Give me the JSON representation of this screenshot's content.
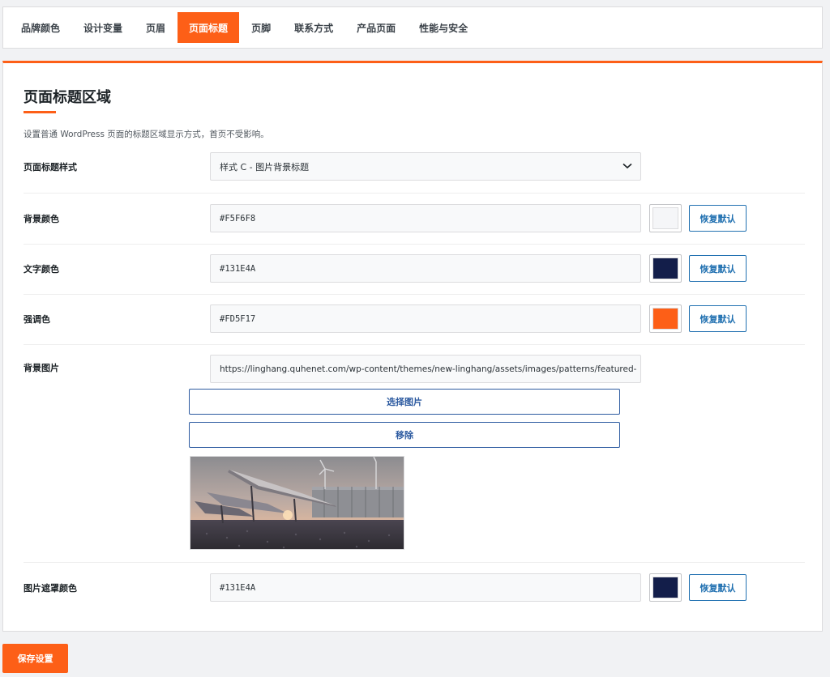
{
  "tabs": [
    {
      "label": "品牌颜色",
      "active": false
    },
    {
      "label": "设计变量",
      "active": false
    },
    {
      "label": "页眉",
      "active": false
    },
    {
      "label": "页面标题",
      "active": true
    },
    {
      "label": "页脚",
      "active": false
    },
    {
      "label": "联系方式",
      "active": false
    },
    {
      "label": "产品页面",
      "active": false
    },
    {
      "label": "性能与安全",
      "active": false
    }
  ],
  "section": {
    "title": "页面标题区域",
    "description": "设置普通 WordPress 页面的标题区域显示方式，首页不受影响。"
  },
  "fields": {
    "title_style": {
      "label": "页面标题样式",
      "value": "样式 C - 图片背景标题"
    },
    "bg_color": {
      "label": "背景颜色",
      "value": "#F5F6F8",
      "swatch": "#f5f6f8",
      "reset_label": "恢复默认"
    },
    "text_color": {
      "label": "文字颜色",
      "value": "#131E4A",
      "swatch": "#131e4a",
      "reset_label": "恢复默认"
    },
    "accent_color": {
      "label": "强调色",
      "value": "#FD5F17",
      "swatch": "#fd5f17",
      "reset_label": "恢复默认"
    },
    "bg_image": {
      "label": "背景图片",
      "value": "https://linghang.quhenet.com/wp-content/themes/new-linghang/assets/images/patterns/featured-",
      "choose_label": "选择图片",
      "remove_label": "移除"
    },
    "overlay_color": {
      "label": "图片遮罩颜色",
      "value": "#131E4A",
      "swatch": "#131e4a",
      "reset_label": "恢复默认"
    }
  },
  "save_label": "保存设置",
  "colors": {
    "accent": "#fd5f17",
    "link": "#2271b1"
  }
}
